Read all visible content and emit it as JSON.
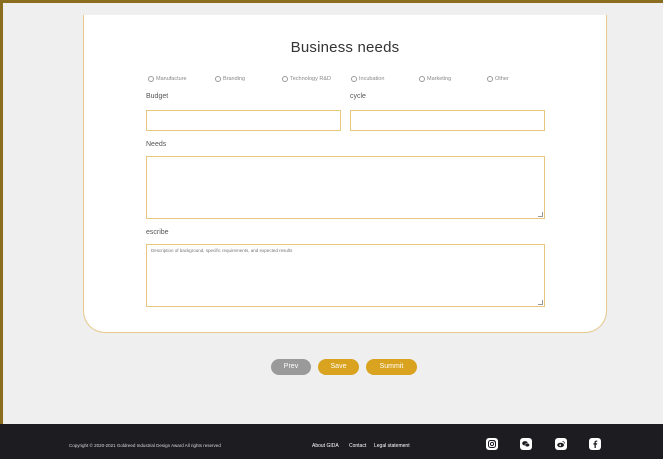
{
  "form": {
    "title": "Business needs",
    "radio_options": [
      "Manufacture",
      "Branding",
      "Technology R&D",
      "Incubation",
      "Marketing",
      "Other"
    ],
    "budget_label": "Budget",
    "cycle_label": "cycle",
    "needs_label": "Needs",
    "describe_label": "escribe",
    "describe_placeholder": "Description of background, specific requirements, and expected results",
    "budget_value": "",
    "cycle_value": "",
    "needs_value": ""
  },
  "buttons": {
    "prev": "Prev",
    "save": "Save",
    "submit": "Summit"
  },
  "colors": {
    "prev_bg": "#9a9a9a",
    "accent": "#d9a21f",
    "field_border": "#e8c77e",
    "footer_bg": "#1c1c21"
  },
  "footer": {
    "copyright": "Copyright © 2020-2021 Goldreed Industrial Design Award All rights reserved",
    "links": [
      "About GIDA",
      "Contact",
      "Legal statement"
    ],
    "social_icons": [
      "instagram-icon",
      "wechat-icon",
      "weibo-icon",
      "facebook-icon"
    ]
  }
}
